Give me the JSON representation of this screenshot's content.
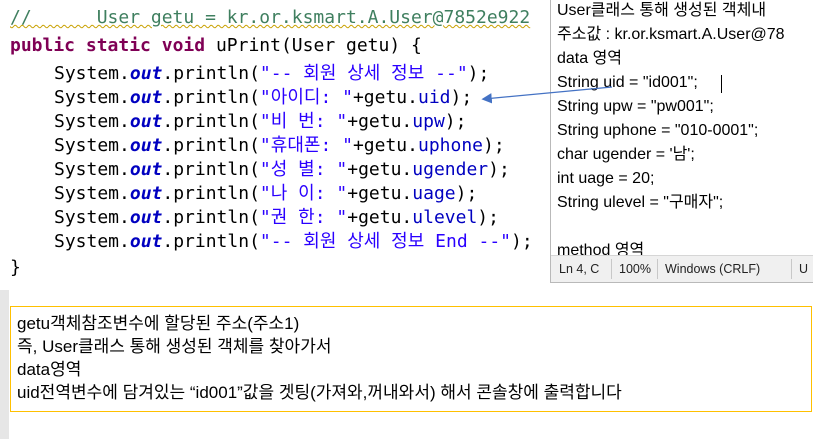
{
  "editor": {
    "comment_line": "//      User getu = kr.or.ksmart.A.User@7852e922",
    "method_signature": {
      "mod1": "public",
      "mod2": "static",
      "ret": "void",
      "name": " uPrint(User getu) {"
    },
    "println_lines": [
      {
        "prefix": "System.",
        "out": "out",
        "call": ".println(",
        "str": "\"-- 회원 상세 정보 --\"",
        "arg": "",
        "field": "",
        "suffix": ");"
      },
      {
        "prefix": "System.",
        "out": "out",
        "call": ".println(",
        "str": "\"아이디: \"",
        "arg": "+getu.",
        "field": "uid",
        "suffix": ");"
      },
      {
        "prefix": "System.",
        "out": "out",
        "call": ".println(",
        "str": "\"비 번: \"",
        "arg": "+getu.",
        "field": "upw",
        "suffix": ");"
      },
      {
        "prefix": "System.",
        "out": "out",
        "call": ".println(",
        "str": "\"휴대폰: \"",
        "arg": "+getu.",
        "field": "uphone",
        "suffix": ");"
      },
      {
        "prefix": "System.",
        "out": "out",
        "call": ".println(",
        "str": "\"성 별: \"",
        "arg": "+getu.",
        "field": "ugender",
        "suffix": ");"
      },
      {
        "prefix": "System.",
        "out": "out",
        "call": ".println(",
        "str": "\"나 이: \"",
        "arg": "+getu.",
        "field": "uage",
        "suffix": ");"
      },
      {
        "prefix": "System.",
        "out": "out",
        "call": ".println(",
        "str": "\"권 한: \"",
        "arg": "+getu.",
        "field": "ulevel",
        "suffix": ");"
      },
      {
        "prefix": "System.",
        "out": "out",
        "call": ".println(",
        "str": "\"-- 회원 상세 정보 End --\"",
        "arg": "",
        "field": "",
        "suffix": ");"
      }
    ],
    "closing_brace": "}"
  },
  "notepad": {
    "lines": [
      "User클래스 통해 생성된 객체내",
      "주소값 : kr.or.ksmart.A.User@78",
      "data 영역",
      "String uid = \"id001\";",
      "String upw = \"pw001\";",
      "String uphone = \"010-0001\";",
      "char ugender = '남';",
      "int uage = 20;",
      "String ulevel = \"구매자\";",
      "",
      "method 영역"
    ],
    "status": {
      "position": "Ln 4, C",
      "zoom": "100%",
      "line_ending": "Windows (CRLF)",
      "encoding": "U"
    }
  },
  "note": {
    "lines": [
      "getu객체참조변수에 할당된 주소(주소1)",
      "즉, User클래스 통해 생성된 객체를 찾아가서",
      "data영역",
      "uid전역변수에 담겨있는 “id001”값을 겟팅(가져와,꺼내와서) 해서 콘솔창에 출력합니다"
    ]
  },
  "colors": {
    "keyword": "#7f0055",
    "comment": "#3f7f5f",
    "string": "#2a00ff",
    "field": "#0000c0",
    "note_border": "#ffc000",
    "arrow": "#4472c4"
  }
}
